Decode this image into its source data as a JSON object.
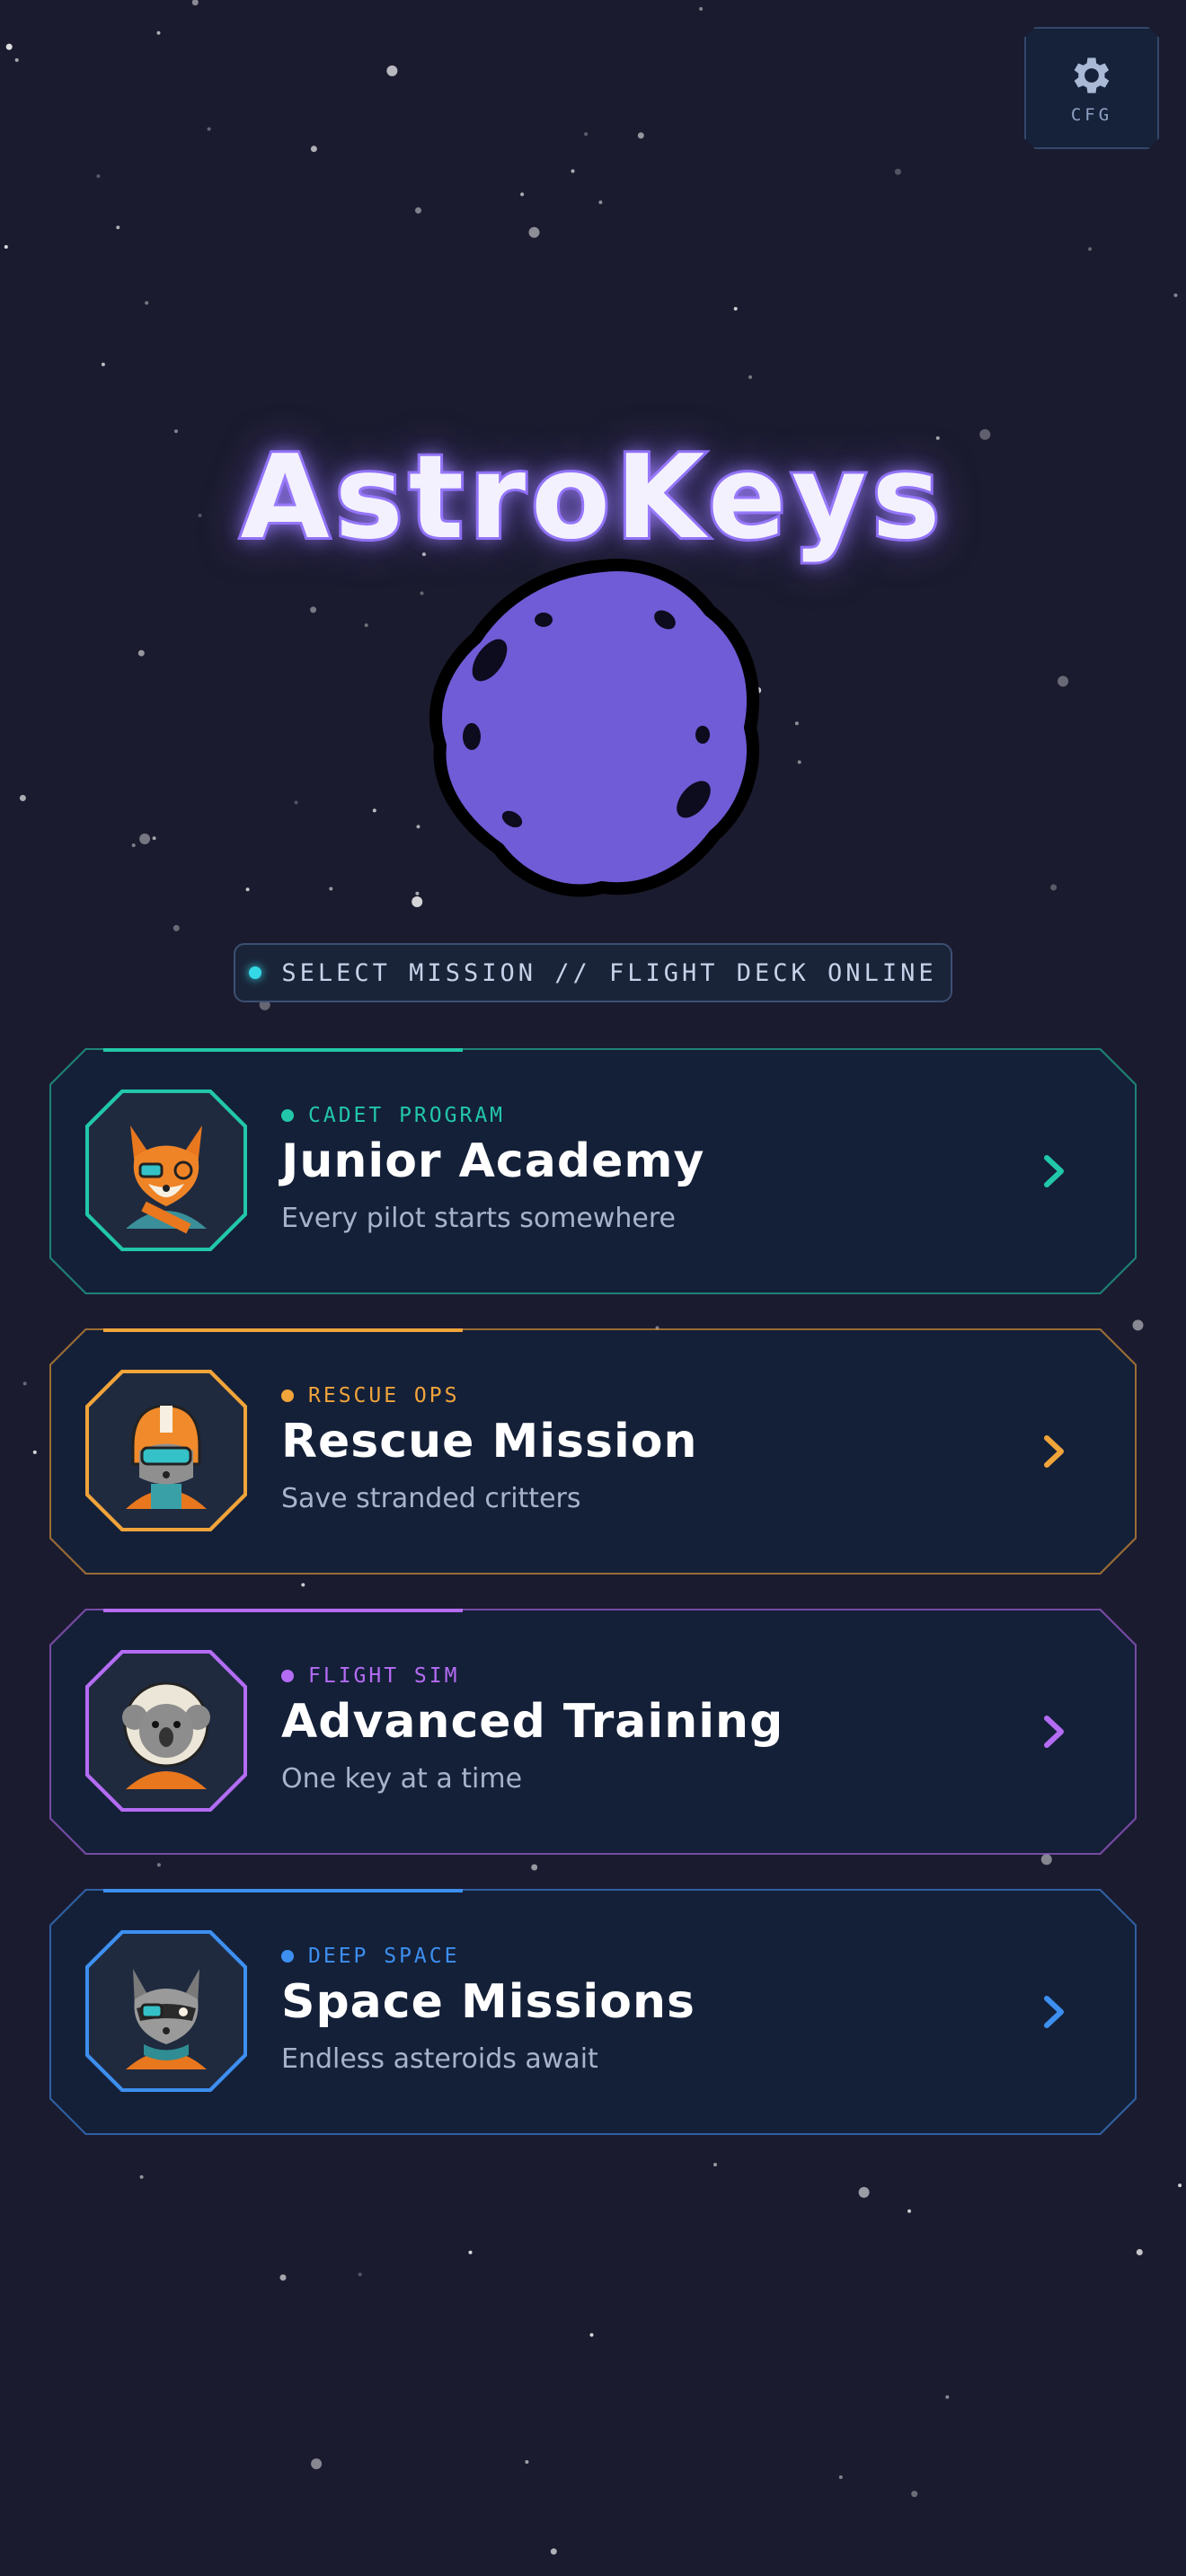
{
  "header": {
    "settings_label": "CFG",
    "settings_icon": "gear-icon"
  },
  "app": {
    "title": "AstroKeys"
  },
  "status": {
    "text": "SELECT MISSION // FLIGHT DECK ONLINE",
    "dot_color": "#34d8e6"
  },
  "missions": [
    {
      "tag": "CADET PROGRAM",
      "title": "Junior Academy",
      "subtitle": "Every pilot starts somewhere",
      "accent": "#22c7a9",
      "avatar": "fox-astronaut-icon"
    },
    {
      "tag": "RESCUE OPS",
      "title": "Rescue Mission",
      "subtitle": "Save stranded critters",
      "accent": "#f0a43a",
      "avatar": "raccoon-pilot-icon"
    },
    {
      "tag": "FLIGHT SIM",
      "title": "Advanced Training",
      "subtitle": "One key at a time",
      "accent": "#b46cf4",
      "avatar": "koala-astronaut-icon"
    },
    {
      "tag": "DEEP SPACE",
      "title": "Space Missions",
      "subtitle": "Endless asteroids await",
      "accent": "#3d8ff0",
      "avatar": "raccoon-astronaut-icon"
    }
  ]
}
